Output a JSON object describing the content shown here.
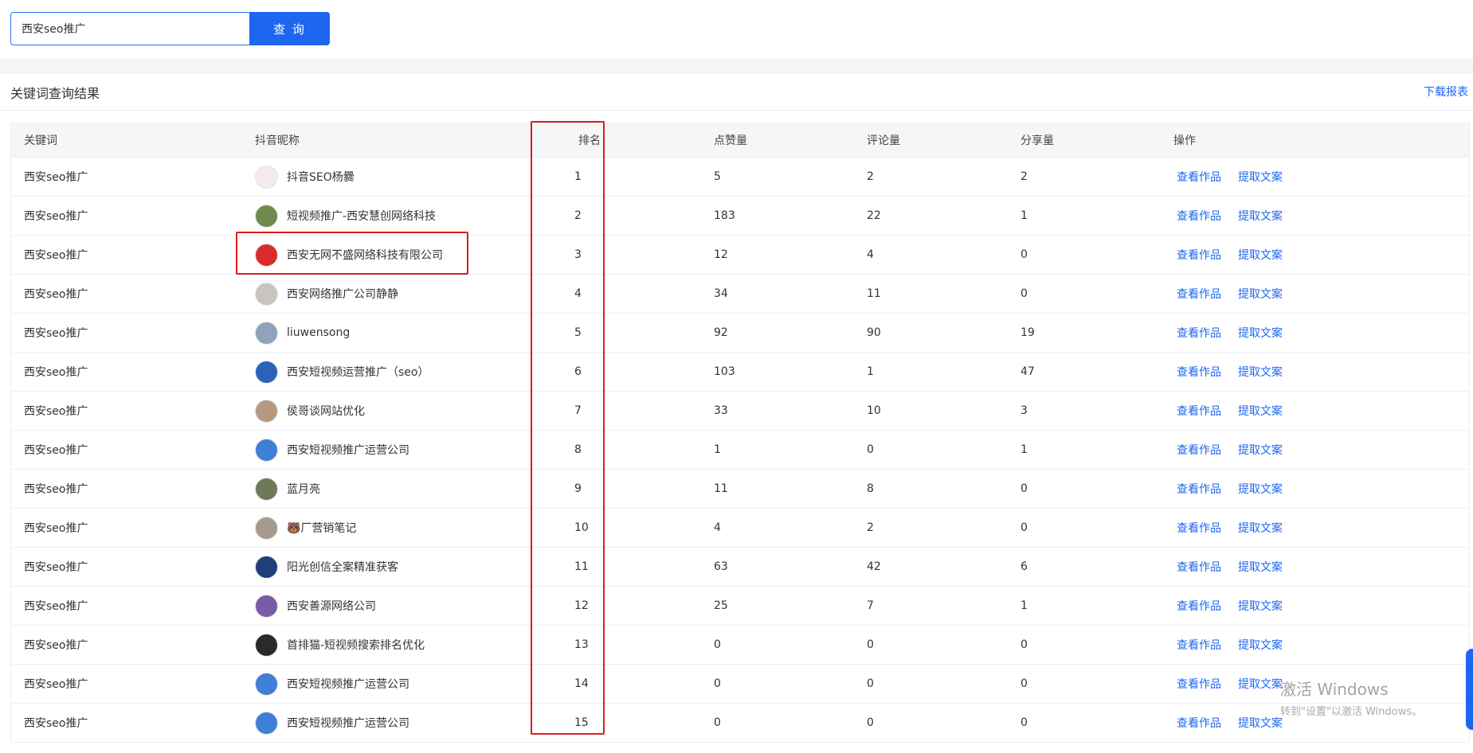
{
  "search": {
    "value": "西安seo推广",
    "button_label": "查 询"
  },
  "results": {
    "title": "关键词查询结果",
    "download_label": "下载报表"
  },
  "table": {
    "headers": {
      "keyword": "关键词",
      "nickname": "抖音昵称",
      "rank": "排名",
      "likes": "点赞量",
      "comments": "评论量",
      "shares": "分享量",
      "ops": "操作"
    },
    "op_labels": {
      "view": "查看作品",
      "extract": "提取文案"
    },
    "rows": [
      {
        "keyword": "西安seo推广",
        "nickname": "抖音SEO杨爨",
        "rank": "1",
        "likes": "5",
        "comments": "2",
        "shares": "2",
        "avatar_color": "#f3e9ef"
      },
      {
        "keyword": "西安seo推广",
        "nickname": "短视频推广-西安慧创网络科技",
        "rank": "2",
        "likes": "183",
        "comments": "22",
        "shares": "1",
        "avatar_color": "#6e8a4e"
      },
      {
        "keyword": "西安seo推广",
        "nickname": "西安无网不盛网络科技有限公司",
        "rank": "3",
        "likes": "12",
        "comments": "4",
        "shares": "0",
        "avatar_color": "#d92b2b"
      },
      {
        "keyword": "西安seo推广",
        "nickname": "西安网络推广公司静静",
        "rank": "4",
        "likes": "34",
        "comments": "11",
        "shares": "0",
        "avatar_color": "#c9c4bd"
      },
      {
        "keyword": "西安seo推广",
        "nickname": "liuwensong",
        "rank": "5",
        "likes": "92",
        "comments": "90",
        "shares": "19",
        "avatar_color": "#8fa3bd"
      },
      {
        "keyword": "西安seo推广",
        "nickname": "西安短视频运营推广（seo）",
        "rank": "6",
        "likes": "103",
        "comments": "1",
        "shares": "47",
        "avatar_color": "#2b63b8"
      },
      {
        "keyword": "西安seo推广",
        "nickname": "侯哥谈网站优化",
        "rank": "7",
        "likes": "33",
        "comments": "10",
        "shares": "3",
        "avatar_color": "#b59a82"
      },
      {
        "keyword": "西安seo推广",
        "nickname": "西安短视频推广运营公司",
        "rank": "8",
        "likes": "1",
        "comments": "0",
        "shares": "1",
        "avatar_color": "#3f7fd6"
      },
      {
        "keyword": "西安seo推广",
        "nickname": "蓝月亮",
        "rank": "9",
        "likes": "11",
        "comments": "8",
        "shares": "0",
        "avatar_color": "#6d7a5a"
      },
      {
        "keyword": "西安seo推广",
        "nickname": "🐻厂营销笔记",
        "rank": "10",
        "likes": "4",
        "comments": "2",
        "shares": "0",
        "avatar_color": "#a69a8c"
      },
      {
        "keyword": "西安seo推广",
        "nickname": "阳光创信全案精准获客",
        "rank": "11",
        "likes": "63",
        "comments": "42",
        "shares": "6",
        "avatar_color": "#1f3f7a"
      },
      {
        "keyword": "西安seo推广",
        "nickname": "西安善源网络公司",
        "rank": "12",
        "likes": "25",
        "comments": "7",
        "shares": "1",
        "avatar_color": "#7a5ca6"
      },
      {
        "keyword": "西安seo推广",
        "nickname": "首排猫-短视频搜索排名优化",
        "rank": "13",
        "likes": "0",
        "comments": "0",
        "shares": "0",
        "avatar_color": "#2a2a2a"
      },
      {
        "keyword": "西安seo推广",
        "nickname": "西安短视频推广运营公司",
        "rank": "14",
        "likes": "0",
        "comments": "0",
        "shares": "0",
        "avatar_color": "#3f7fd6"
      },
      {
        "keyword": "西安seo推广",
        "nickname": "西安短视频推广运营公司",
        "rank": "15",
        "likes": "0",
        "comments": "0",
        "shares": "0",
        "avatar_color": "#3f7fd6"
      }
    ]
  },
  "watermark": {
    "line1": "激活 Windows",
    "line2": "转到\"设置\"以激活 Windows。"
  }
}
